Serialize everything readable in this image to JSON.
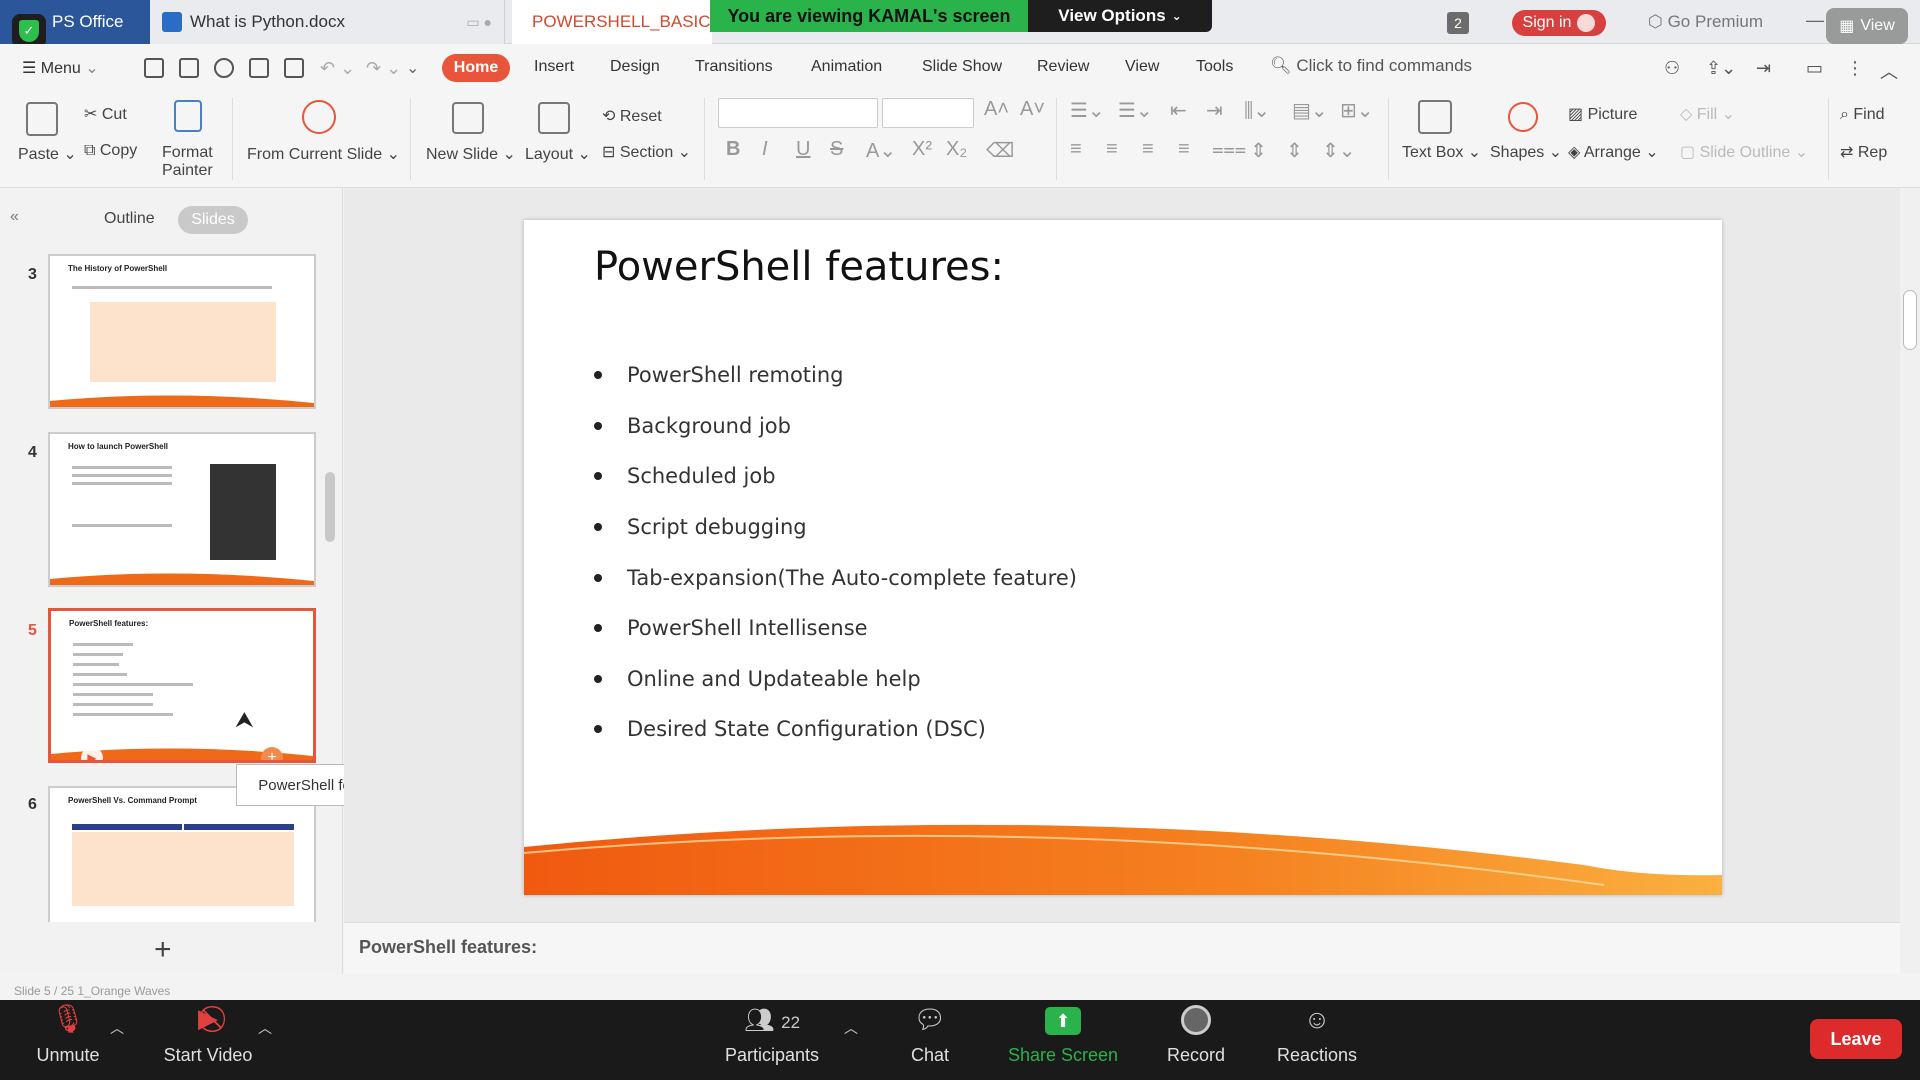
{
  "titlebar": {
    "app_tab": "PS Office",
    "doc_tab": "What is Python.docx",
    "active_tab": "POWERSHELL_BASIC",
    "share_banner": "You are viewing KAMAL's screen",
    "view_options": "View Options",
    "window_count": "2",
    "sign_in": "Sign in",
    "go_premium": "Go Premium",
    "view_button": "View"
  },
  "menu": {
    "menu_label": "Menu",
    "tabs": [
      "Home",
      "Insert",
      "Design",
      "Transitions",
      "Animation",
      "Slide Show",
      "Review",
      "View",
      "Tools"
    ],
    "find_placeholder": "Click to find commands"
  },
  "ribbon": {
    "paste": "Paste",
    "cut": "Cut",
    "copy": "Copy",
    "format_painter_1": "Format",
    "format_painter_2": "Painter",
    "from_current_slide": "From Current Slide",
    "new_slide": "New Slide",
    "layout": "Layout",
    "reset": "Reset",
    "section": "Section",
    "text_box": "Text Box",
    "shapes": "Shapes",
    "picture": "Picture",
    "arrange": "Arrange",
    "fill": "Fill",
    "slide_outline": "Slide Outline",
    "find": "Find",
    "replace": "Rep"
  },
  "sidepanel": {
    "outline_tab": "Outline",
    "slides_tab": "Slides",
    "thumbnails": [
      {
        "num": "3",
        "title": "The History of PowerShell"
      },
      {
        "num": "4",
        "title": "How to launch PowerShell"
      },
      {
        "num": "5",
        "title": "PowerShell features:"
      },
      {
        "num": "6",
        "title": "PowerShell Vs. Command Prompt"
      }
    ],
    "tooltip": "PowerShell features:"
  },
  "slide": {
    "title": "PowerShell features:",
    "bullets": [
      "PowerShell remoting",
      "Background job",
      "Scheduled job",
      "Script debugging",
      "Tab-expansion(The Auto-complete feature)",
      "PowerShell Intellisense",
      "Online and Updateable help",
      "Desired State Configuration (DSC)"
    ]
  },
  "notes": {
    "text": "PowerShell features:"
  },
  "status": {
    "text": "Slide 5 / 25    1_Orange Waves"
  },
  "zoom_controls": {
    "unmute": "Unmute",
    "start_video": "Start Video",
    "participants": "Participants",
    "participants_count": "22",
    "chat": "Chat",
    "share_screen": "Share Screen",
    "record": "Record",
    "reactions": "Reactions",
    "leave": "Leave"
  },
  "colors": {
    "accent": "#e8553b",
    "share_green": "#2ab24b",
    "leave_red": "#dd2a2a"
  }
}
